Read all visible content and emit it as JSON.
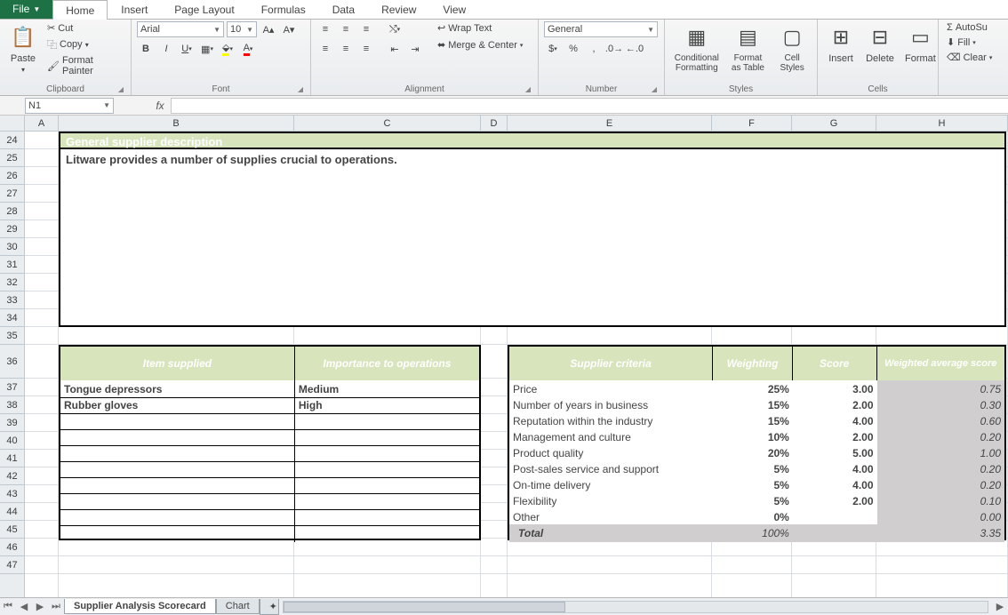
{
  "tabs": {
    "file": "File",
    "items": [
      "Home",
      "Insert",
      "Page Layout",
      "Formulas",
      "Data",
      "Review",
      "View"
    ],
    "active": "Home"
  },
  "ribbon": {
    "clipboard": {
      "label": "Clipboard",
      "paste": "Paste",
      "cut": "Cut",
      "copy": "Copy",
      "painter": "Format Painter"
    },
    "font": {
      "label": "Font",
      "name": "Arial",
      "size": "10"
    },
    "alignment": {
      "label": "Alignment",
      "wrap": "Wrap Text",
      "merge": "Merge & Center"
    },
    "number": {
      "label": "Number",
      "format": "General"
    },
    "styles": {
      "label": "Styles",
      "cond": "Conditional Formatting",
      "table": "Format as Table",
      "cell": "Cell Styles"
    },
    "cells": {
      "label": "Cells",
      "insert": "Insert",
      "delete": "Delete",
      "format": "Format"
    },
    "editing": {
      "autosum": "AutoSu",
      "fill": "Fill",
      "clear": "Clear"
    }
  },
  "formula_bar": {
    "name_box": "N1",
    "fx": "fx",
    "formula": ""
  },
  "columns": [
    "A",
    "B",
    "C",
    "D",
    "E",
    "F",
    "G",
    "H"
  ],
  "row_start": 24,
  "row_end": 47,
  "section_header": "General supplier description",
  "description": "Litware provides a number of supplies crucial to operations.",
  "items_table": {
    "headers": [
      "Item supplied",
      "Importance to operations"
    ],
    "rows": [
      [
        "Tongue depressors",
        "Medium"
      ],
      [
        "Rubber gloves",
        "High"
      ],
      [
        "",
        ""
      ],
      [
        "",
        ""
      ],
      [
        "",
        ""
      ],
      [
        "",
        ""
      ],
      [
        "",
        ""
      ],
      [
        "",
        ""
      ],
      [
        "",
        ""
      ],
      [
        "",
        ""
      ]
    ]
  },
  "criteria_table": {
    "headers": [
      "Supplier criteria",
      "Weighting",
      "Score",
      "Weighted average score"
    ],
    "rows": [
      {
        "c": "Price",
        "w": "25%",
        "s": "3.00",
        "wa": "0.75"
      },
      {
        "c": "Number of years in business",
        "w": "15%",
        "s": "2.00",
        "wa": "0.30"
      },
      {
        "c": "Reputation within the industry",
        "w": "15%",
        "s": "4.00",
        "wa": "0.60"
      },
      {
        "c": "Management and culture",
        "w": "10%",
        "s": "2.00",
        "wa": "0.20"
      },
      {
        "c": "Product quality",
        "w": "20%",
        "s": "5.00",
        "wa": "1.00"
      },
      {
        "c": "Post-sales service and support",
        "w": "5%",
        "s": "4.00",
        "wa": "0.20"
      },
      {
        "c": "On-time delivery",
        "w": "5%",
        "s": "4.00",
        "wa": "0.20"
      },
      {
        "c": "Flexibility",
        "w": "5%",
        "s": "2.00",
        "wa": "0.10"
      },
      {
        "c": "Other",
        "w": "0%",
        "s": "",
        "wa": "0.00"
      }
    ],
    "total": {
      "label": "Total",
      "w": "100%",
      "s": "",
      "wa": "3.35"
    }
  },
  "sheet_tabs": {
    "active": "Supplier Analysis Scorecard",
    "others": [
      "Chart"
    ]
  }
}
